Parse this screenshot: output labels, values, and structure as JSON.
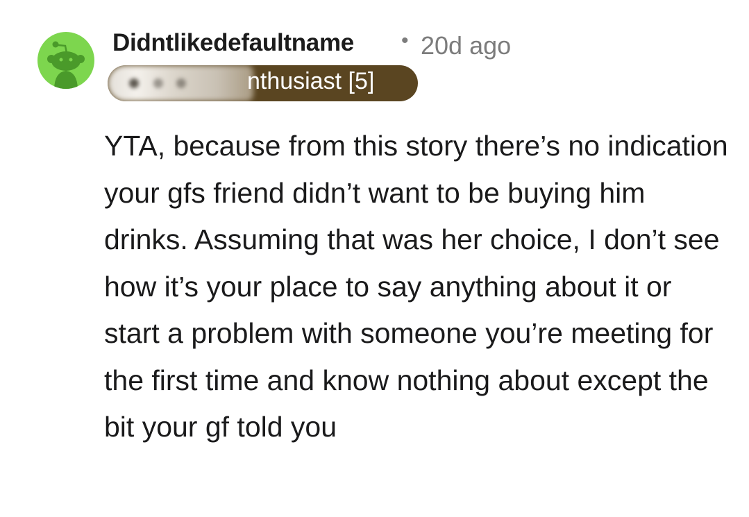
{
  "comment": {
    "username": "Didntlikedefaultname",
    "separator": "•",
    "timestamp": "20d ago",
    "flair": {
      "visible_text": "nthusiast [5]",
      "bg_color": "#5a4521",
      "text_color": "#ffffff"
    },
    "avatar": {
      "icon": "reddit-snoo-icon",
      "bg_color": "#7dd64e"
    },
    "body": "YTA, because from this story there’s no indication your gfs friend didn’t want to be buying him drinks. Assuming that was her choice, I don’t see how it’s your place to say anything about it or start a problem with someone you’re meeting for the first time and know nothing about except the bit your gf told you"
  }
}
